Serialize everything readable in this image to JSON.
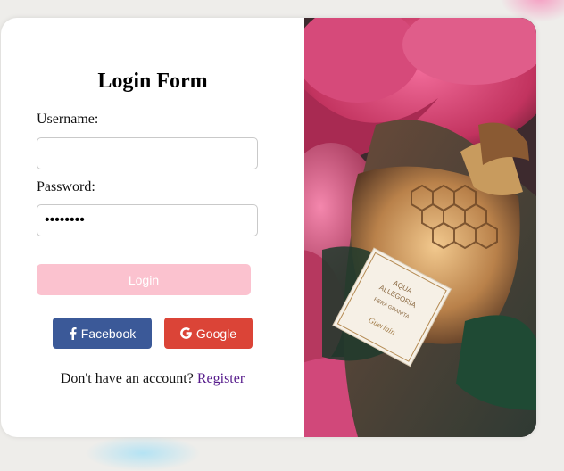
{
  "form": {
    "title": "Login Form",
    "username_label": "Username:",
    "username_value": "",
    "password_label": "Password:",
    "password_value": "password",
    "login_label": "Login"
  },
  "social": {
    "facebook_label": "Facebook",
    "google_label": "Google",
    "facebook_color": "#3b5998",
    "google_color": "#db4437"
  },
  "register": {
    "prompt": "Don't have an account?",
    "link_label": "Register"
  },
  "image": {
    "bottle_label_line1": "AQUA",
    "bottle_label_line2": "ALLEGORIA",
    "bottle_label_line3": "PERA GRANITA",
    "bottle_label_line4": "Guerlain"
  },
  "colors": {
    "login_button": "#fbc2cf",
    "page_background": "#eeedea"
  }
}
